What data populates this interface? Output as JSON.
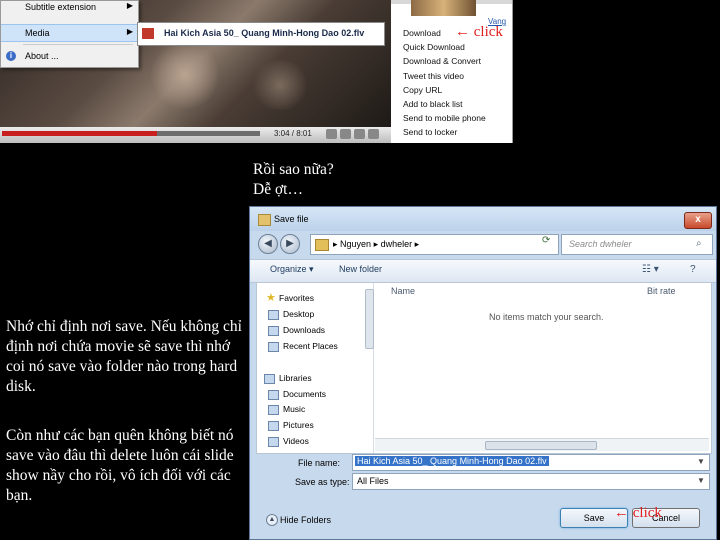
{
  "context_menu": {
    "items": [
      {
        "label": "Subtitle extension"
      },
      {
        "label": "Media"
      },
      {
        "label": "About ..."
      }
    ]
  },
  "media_window": {
    "title": "Hai Kich Asia 50_ Quang Minh-Hong Dao 02.flv"
  },
  "player": {
    "time": "3:04 / 8:01",
    "progress": 0.6
  },
  "download_menu": {
    "link": "Vang",
    "items": [
      "Download",
      "Quick Download",
      "Download & Convert",
      "Tweet this video",
      "Copy URL",
      "Add to black list",
      "Send to mobile phone",
      "Send to locker"
    ]
  },
  "annotations": {
    "arrow": "←",
    "click": "click"
  },
  "captions": {
    "question_line1": "Rồi sao nữa?",
    "question_line2": "Dễ ợt…",
    "instruction": "Nhớ chỉ định nơi save. Nếu không chỉ định nơi chứa movie sẽ save thì nhớ coi nó save vào folder nào trong hard disk.",
    "closing": "Còn như các bạn quên không biết nó save vào đâu thì delete luôn cái slide show nầy cho rồi, vô ích đối với các bạn."
  },
  "dialog": {
    "title": "Save file",
    "close": "x",
    "path": [
      "Nguyen",
      "dwheler"
    ],
    "search_placeholder": "Search dwheler",
    "toolbar": {
      "organize": "Organize ▾",
      "new_folder": "New folder"
    },
    "nav": {
      "favorites": "Favorites",
      "favorites_items": [
        "Desktop",
        "Downloads",
        "Recent Places"
      ],
      "libraries": "Libraries",
      "libraries_items": [
        "Documents",
        "Music",
        "Pictures",
        "Videos"
      ]
    },
    "columns": {
      "name": "Name",
      "date": "Bit rate"
    },
    "empty_message": "No items match your search.",
    "file_name_label": "File name:",
    "file_name_value": "Hai Kich Asia 50_ Quang Minh-Hong Dao 02.flv",
    "save_as_type_label": "Save as type:",
    "save_as_type_value": "All Files",
    "hide_folders": "Hide Folders",
    "save": "Save",
    "cancel": "Cancel"
  }
}
